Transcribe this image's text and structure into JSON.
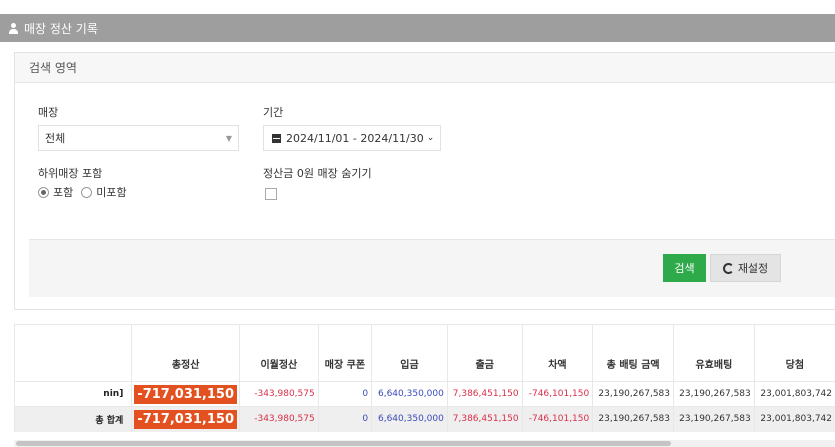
{
  "header": {
    "title": "매장 정산 기록"
  },
  "search_panel": {
    "title": "검색 영역",
    "store": {
      "label": "매장",
      "value": "전체",
      "caret": "▼"
    },
    "period": {
      "label": "기간",
      "value": "2024/11/01 - 2024/11/30",
      "chevron": "⌄"
    },
    "sub_store": {
      "label": "하위매장 포함",
      "options": [
        "포함",
        "미포함"
      ],
      "selected": "포함"
    },
    "hide_zero": {
      "label": "정산금 0원 매장 숨기기",
      "checked": false
    },
    "buttons": {
      "search": "검색",
      "reset": "재설정"
    }
  },
  "table": {
    "headers": [
      "",
      "총정산",
      "이월정산",
      "매장 쿠폰",
      "입금",
      "출금",
      "차액",
      "총 배팅 금액",
      "유효배팅",
      "당첨"
    ],
    "rows": [
      {
        "name": "nin]",
        "total": "-717,031,150",
        "carry": "-343,980,575",
        "coupon": "0",
        "deposit": "6,640,350,000",
        "withdraw": "7,386,451,150",
        "diff": "-746,101,150",
        "bet_total": "23,190,267,583",
        "valid_bet": "23,190,267,583",
        "win": "23,001,803,742"
      },
      {
        "name": "총 합계",
        "total": "-717,031,150",
        "carry": "-343,980,575",
        "coupon": "0",
        "deposit": "6,640,350,000",
        "withdraw": "7,386,451,150",
        "diff": "-746,101,150",
        "bet_total": "23,190,267,583",
        "valid_bet": "23,190,267,583",
        "win": "23,001,803,742"
      }
    ]
  },
  "colors": {
    "header_bg": "#9e9e9e",
    "search_button": "#2eaa4a",
    "total_badge": "#e2511f",
    "negative": "#d9304a",
    "deposit_blue": "#3a4bb8"
  },
  "icons": {
    "header": "user-icon",
    "period": "calendar-icon",
    "reset": "refresh-icon"
  }
}
